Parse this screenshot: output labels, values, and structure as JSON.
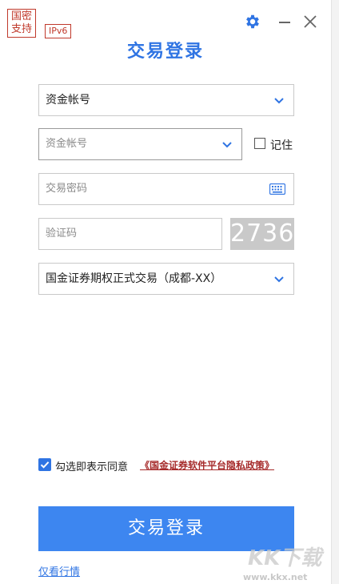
{
  "badges": {
    "guomi_line1": "国密",
    "guomi_line2": "支持",
    "ipv6": "IPv6"
  },
  "header": {
    "title": "交易登录"
  },
  "account_type": {
    "value": "资金帐号"
  },
  "account": {
    "placeholder": "资金帐号",
    "remember_label": "记住",
    "remember_checked": false
  },
  "password": {
    "placeholder": "交易密码"
  },
  "captcha": {
    "placeholder": "验证码",
    "code": "2736"
  },
  "server": {
    "value": "国金证券期权正式交易（成都-XX）"
  },
  "agreement": {
    "checked": true,
    "text": "勾选即表示同意",
    "link": "《国金证券软件平台隐私政策》"
  },
  "login_button": {
    "label": "交易登录"
  },
  "view_quotes_link": {
    "label": "仅看行情"
  },
  "watermark": {
    "logo": "KK下载",
    "url": "www.kkx.net"
  },
  "colors": {
    "accent": "#2f74e3",
    "button": "#3d86f0",
    "badge": "#c0392b",
    "link_red": "#a62b2b",
    "captcha_bg": "#c9c9c9"
  }
}
